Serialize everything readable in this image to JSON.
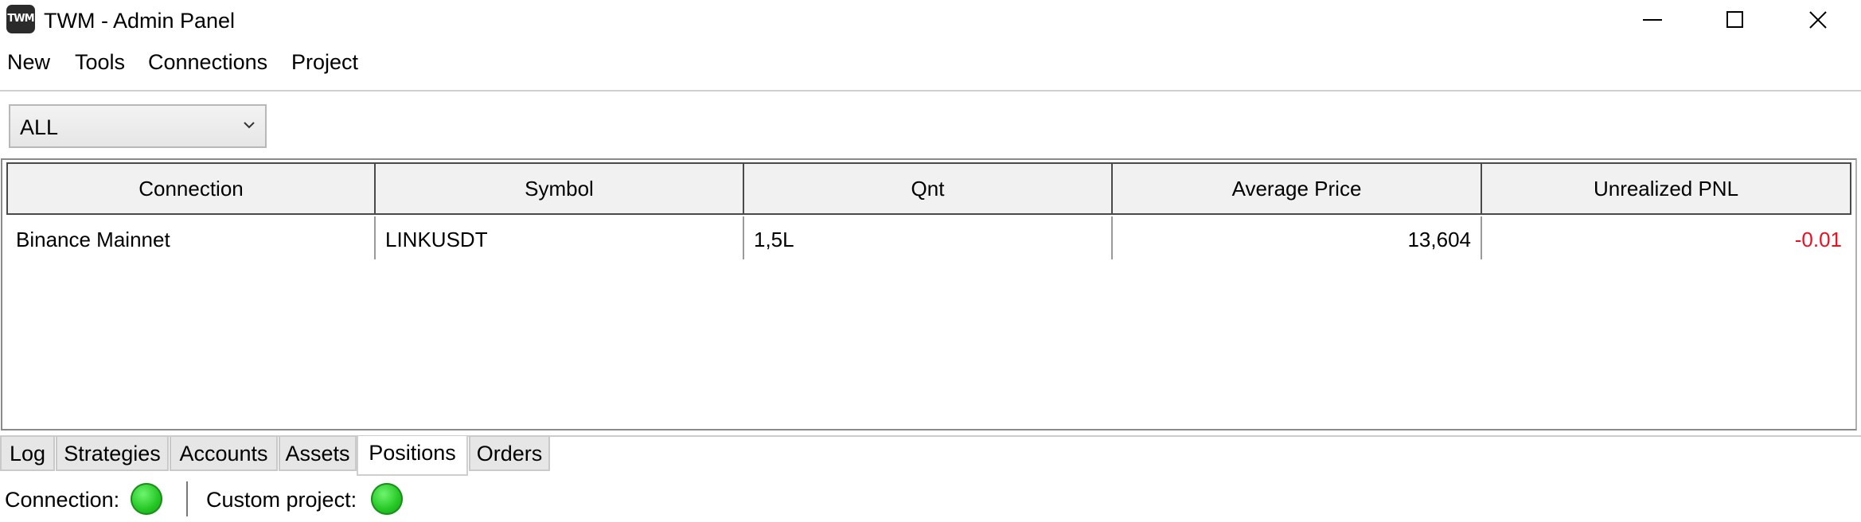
{
  "window": {
    "title": "TWM - Admin Panel",
    "icon_text": "TWM"
  },
  "menu": [
    "New",
    "Tools",
    "Connections",
    "Project"
  ],
  "filter": {
    "selected": "ALL"
  },
  "table": {
    "columns": [
      "Connection",
      "Symbol",
      "Qnt",
      "Average Price",
      "Unrealized PNL"
    ],
    "rows": [
      {
        "connection": "Binance Mainnet",
        "symbol": "LINKUSDT",
        "qnt": "1,5L",
        "avg_price": "13,604",
        "pnl": "-0.01"
      }
    ]
  },
  "tabs": [
    "Log",
    "Strategies",
    "Accounts",
    "Assets",
    "Positions",
    "Orders"
  ],
  "active_tab": "Positions",
  "status": {
    "connection_label": "Connection:",
    "custom_project_label": "Custom project:",
    "connection_status": "green",
    "custom_project_status": "green"
  },
  "colors": {
    "negative": "#e81123",
    "ok": "#25c725"
  }
}
